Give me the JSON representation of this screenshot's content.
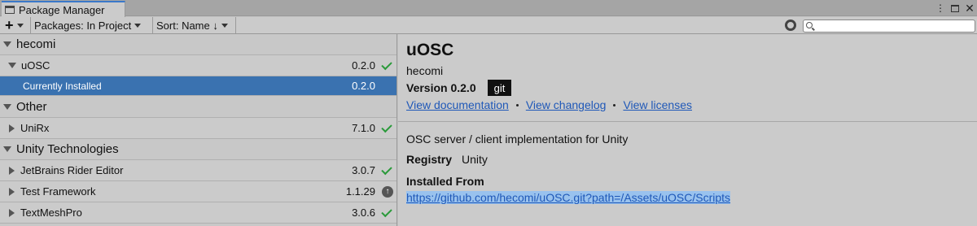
{
  "window": {
    "title": "Package Manager"
  },
  "toolbar": {
    "add_label": "+",
    "packages_dropdown": "Packages: In Project",
    "sort_dropdown": "Sort: Name ↓",
    "search_value": ""
  },
  "list": {
    "groups": [
      {
        "name": "hecomi"
      },
      {
        "name": "Other"
      },
      {
        "name": "Unity Technologies"
      }
    ],
    "packages": [
      {
        "name": "uOSC",
        "version": "0.2.0",
        "status": "installed",
        "expanded": true
      },
      {
        "name": "Currently Installed",
        "version": "0.2.0",
        "selected": true
      },
      {
        "name": "UniRx",
        "version": "7.1.0",
        "status": "installed"
      },
      {
        "name": "JetBrains Rider Editor",
        "version": "3.0.7",
        "status": "installed"
      },
      {
        "name": "Test Framework",
        "version": "1.1.29",
        "status": "update-available"
      },
      {
        "name": "TextMeshPro",
        "version": "3.0.6",
        "status": "installed"
      }
    ]
  },
  "detail": {
    "title": "uOSC",
    "author": "hecomi",
    "version_label": "Version 0.2.0",
    "source_badge": "git",
    "links": {
      "documentation": "View documentation",
      "changelog": "View changelog",
      "licenses": "View licenses"
    },
    "description": "OSC server / client implementation for Unity",
    "registry_label": "Registry",
    "registry_value": "Unity",
    "installed_from_label": "Installed From",
    "installed_from_url": "https://github.com/hecomi/uOSC.git?path=/Assets/uOSC/Scripts"
  },
  "colors": {
    "selection": "#3a72b0",
    "link": "#1f58b8",
    "check": "#2a9a3a",
    "tab_accent": "#3a78c9"
  }
}
